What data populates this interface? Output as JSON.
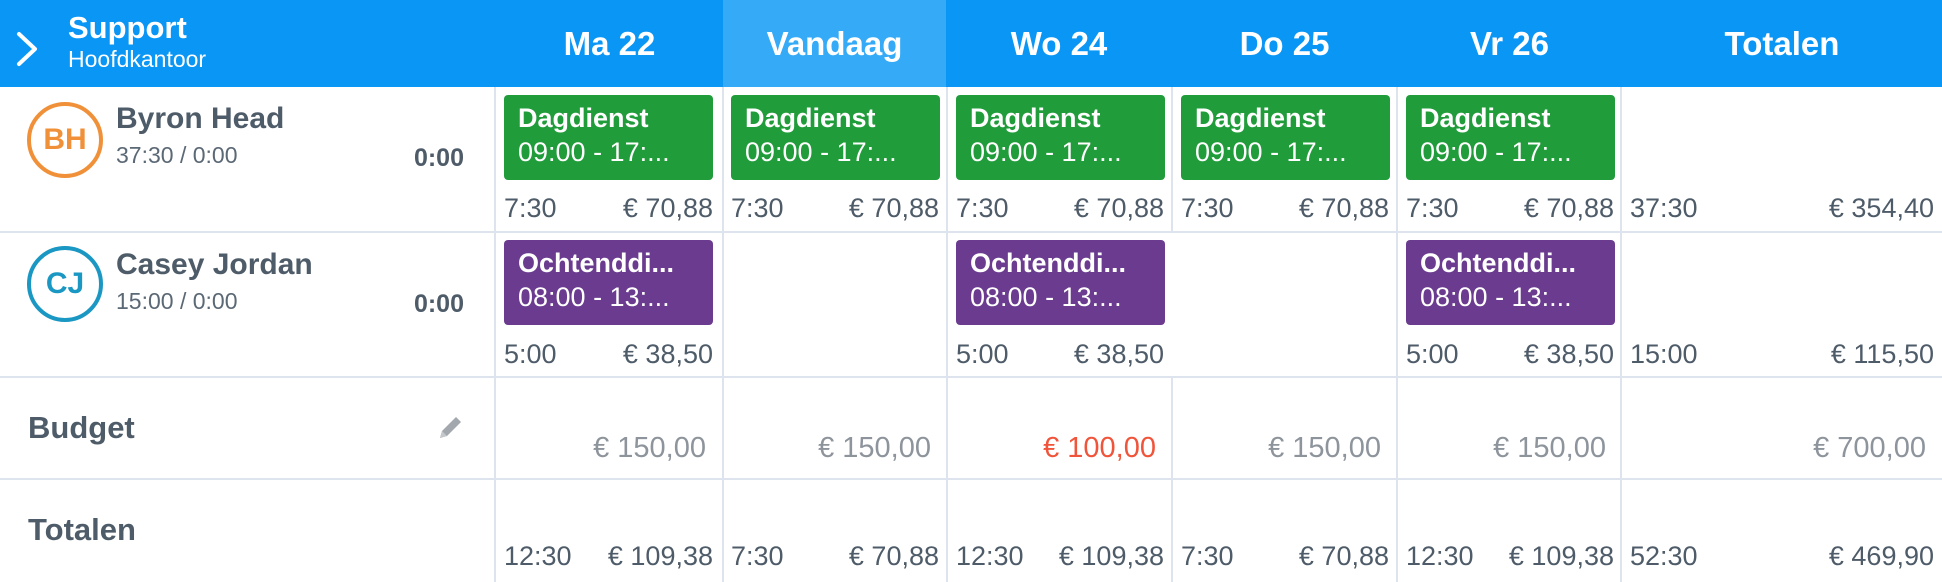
{
  "header": {
    "team_name": "Support",
    "team_location": "Hoofdkantoor",
    "days": [
      "Ma 22",
      "Vandaag",
      "Wo 24",
      "Do 25",
      "Vr 26"
    ],
    "totals_label": "Totalen"
  },
  "employees": [
    {
      "initials": "BH",
      "name": "Byron Head",
      "hours": "37:30 / 0:00",
      "total": "0:00",
      "avatar_color": "#f0913a",
      "days": [
        {
          "shift": "Dagdienst",
          "time": "09:00 - 17:...",
          "hours": "7:30",
          "cost": "€ 70,88"
        },
        {
          "shift": "Dagdienst",
          "time": "09:00 - 17:...",
          "hours": "7:30",
          "cost": "€ 70,88"
        },
        {
          "shift": "Dagdienst",
          "time": "09:00 - 17:...",
          "hours": "7:30",
          "cost": "€ 70,88"
        },
        {
          "shift": "Dagdienst",
          "time": "09:00 - 17:...",
          "hours": "7:30",
          "cost": "€ 70,88"
        },
        {
          "shift": "Dagdienst",
          "time": "09:00 - 17:...",
          "hours": "7:30",
          "cost": "€ 70,88"
        }
      ],
      "week_hours": "37:30",
      "week_cost": "€ 354,40"
    },
    {
      "initials": "CJ",
      "name": "Casey Jordan",
      "hours": "15:00 / 0:00",
      "total": "0:00",
      "avatar_color": "#1a97c2",
      "days": [
        {
          "shift": "Ochtenddi...",
          "time": "08:00 - 13:...",
          "hours": "5:00",
          "cost": "€ 38,50"
        },
        null,
        {
          "shift": "Ochtenddi...",
          "time": "08:00 - 13:...",
          "hours": "5:00",
          "cost": "€ 38,50"
        },
        null,
        {
          "shift": "Ochtenddi...",
          "time": "08:00 - 13:...",
          "hours": "5:00",
          "cost": "€ 38,50"
        }
      ],
      "week_hours": "15:00",
      "week_cost": "€ 115,50"
    }
  ],
  "budget": {
    "label": "Budget",
    "values": [
      "€ 150,00",
      "€ 150,00",
      "€ 100,00",
      "€ 150,00",
      "€ 150,00"
    ],
    "total": "€ 700,00",
    "over_color": "#f0553b"
  },
  "totals": {
    "label": "Totalen",
    "days": [
      {
        "hours": "12:30",
        "cost": "€ 109,38"
      },
      {
        "hours": "7:30",
        "cost": "€ 70,88"
      },
      {
        "hours": "12:30",
        "cost": "€ 109,38"
      },
      {
        "hours": "7:30",
        "cost": "€ 70,88"
      },
      {
        "hours": "12:30",
        "cost": "€ 109,38"
      }
    ],
    "week_hours": "52:30",
    "week_cost": "€ 469,90"
  },
  "colors": {
    "header": "#0a96f5",
    "today": "#35abf8",
    "shift_day": "#219c3b",
    "shift_morning": "#6a3b8f"
  }
}
